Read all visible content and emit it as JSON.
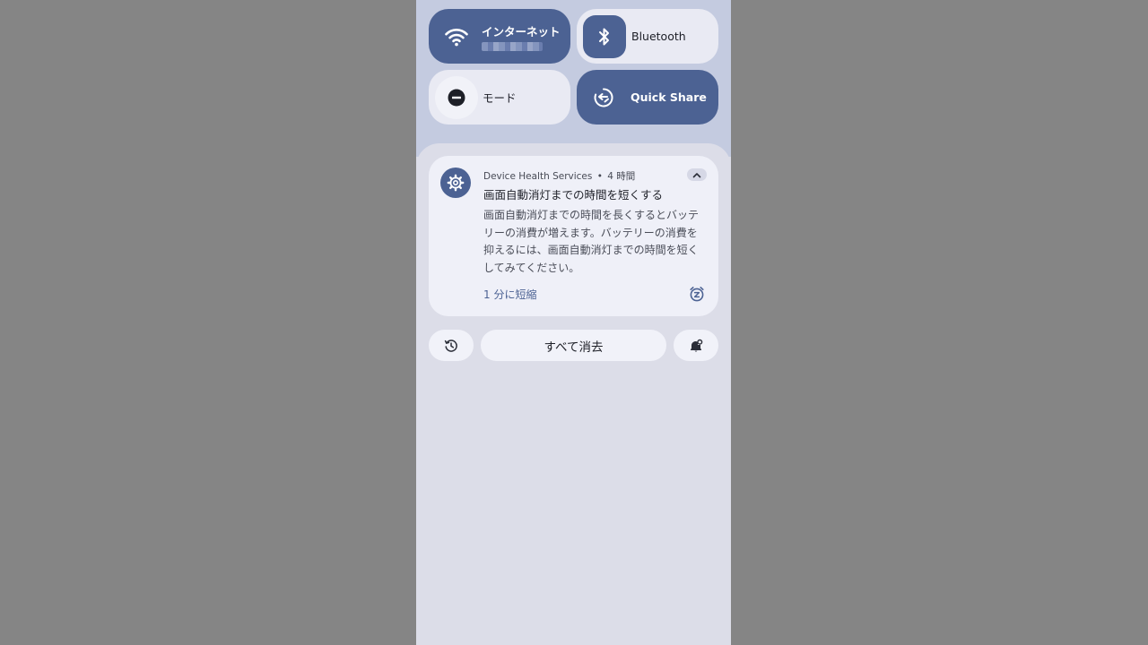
{
  "quick_settings": {
    "internet": {
      "label": "インターネット",
      "state": "on",
      "icon": "wifi-icon"
    },
    "bluetooth": {
      "label": "Bluetooth",
      "state": "off",
      "icon": "bluetooth-icon"
    },
    "modes": {
      "label": "モード",
      "state": "off",
      "icon": "do-not-disturb-icon"
    },
    "quick_share": {
      "label": "Quick Share",
      "state": "on",
      "icon": "quick-share-icon"
    }
  },
  "notification": {
    "app_name": "Device Health Services",
    "separator": "•",
    "time": "4 時間",
    "icon": "gear-icon",
    "title": "画面自動消灯までの時間を短くする",
    "body": "画面自動消灯までの時間を長くするとバッテリーの消費が増えます。バッテリーの消費を抑えるには、画面自動消灯までの時間を短くしてみてください。",
    "action_label": "1 分に短縮"
  },
  "footer": {
    "history_icon": "history-icon",
    "clear_all_label": "すべて消去",
    "settings_icon": "notification-settings-icon"
  },
  "colors": {
    "accent": "#4c6293",
    "qs_background": "#c4cbe0",
    "panel_background": "#dcdde8",
    "card_background": "#eff0f8",
    "outside_background": "#858585"
  }
}
